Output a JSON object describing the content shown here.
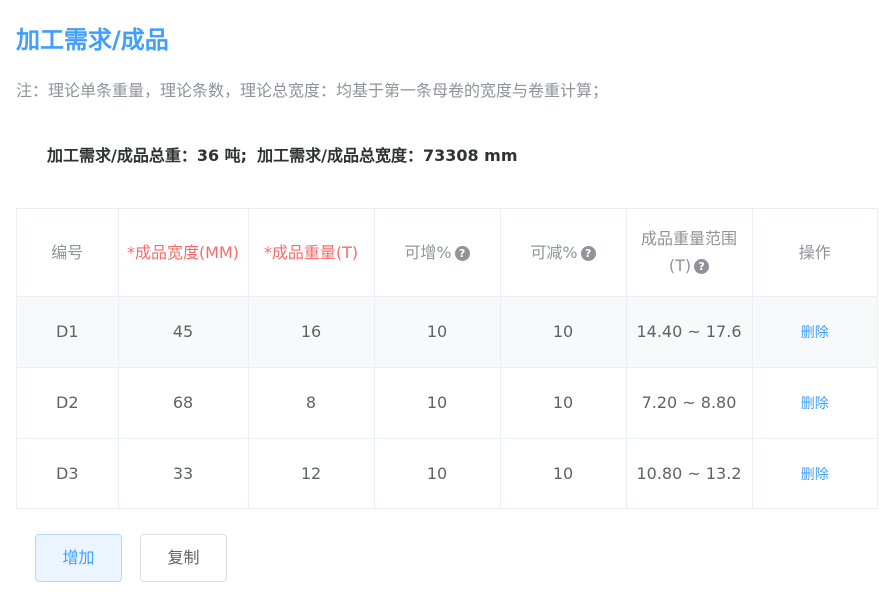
{
  "title": "加工需求/成品",
  "note": "注：理论单条重量，理论条数，理论总宽度：均基于第一条母卷的宽度与卷重计算；",
  "summary": {
    "weight_text": "加工需求/成品总重：36 吨;",
    "width_text": "加工需求/成品总宽度：73308 mm"
  },
  "table": {
    "headers": {
      "code": "编号",
      "width": "*成品宽度(MM)",
      "weight": "*成品重量(T)",
      "increase": "可增%",
      "decrease": "可减%",
      "range": "成品重量范围(T)",
      "action": "操作"
    },
    "help_icon": "?",
    "rows": [
      {
        "code": "D1",
        "width": "45",
        "weight": "16",
        "increase": "10",
        "decrease": "10",
        "range": "14.40 ~ 17.6",
        "action": "删除"
      },
      {
        "code": "D2",
        "width": "68",
        "weight": "8",
        "increase": "10",
        "decrease": "10",
        "range": "7.20 ~ 8.80",
        "action": "删除"
      },
      {
        "code": "D3",
        "width": "33",
        "weight": "12",
        "increase": "10",
        "decrease": "10",
        "range": "10.80 ~ 13.2",
        "action": "删除"
      }
    ]
  },
  "buttons": {
    "add": "增加",
    "copy": "复制"
  },
  "colors": {
    "primary": "#409eff",
    "required": "#f56c6c",
    "muted": "#909399"
  },
  "icons": {
    "help": "question-circle-icon"
  }
}
